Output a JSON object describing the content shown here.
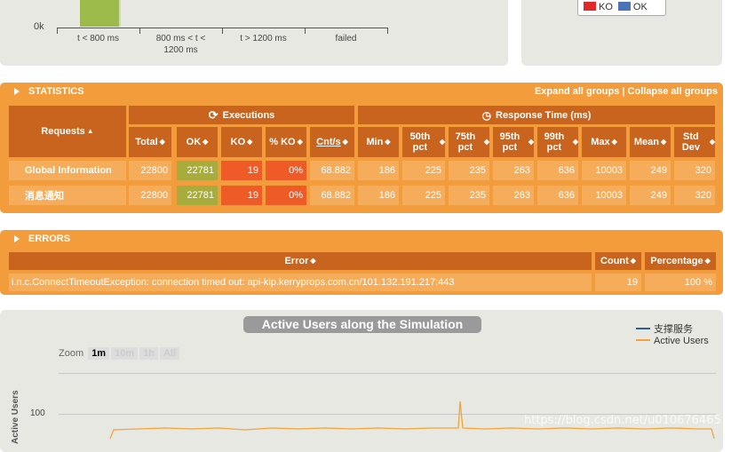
{
  "top_chart": {
    "y_tick": "0k",
    "x_labels": [
      "t < 800 ms",
      "800 ms < t <\n1200 ms",
      "t > 1200 ms",
      "failed"
    ],
    "legend": [
      {
        "label": "KO",
        "color": "#e02a2a"
      },
      {
        "label": "OK",
        "color": "#4a74b4"
      }
    ]
  },
  "statistics": {
    "title": "STATISTICS",
    "expand_link": "Expand all groups",
    "separator": "|",
    "collapse_link": "Collapse all groups",
    "group_executions": "Executions",
    "group_response_time": "Response Time (ms)",
    "requests_header": "Requests",
    "columns": [
      "Total",
      "OK",
      "KO",
      "% KO",
      "Cnt/s",
      "Min",
      "50th pct",
      "75th pct",
      "95th pct",
      "99th pct",
      "Max",
      "Mean",
      "Std Dev"
    ],
    "rows": [
      {
        "name": "Global Information",
        "values": [
          "22800",
          "22781",
          "19",
          "0%",
          "68.882",
          "186",
          "225",
          "235",
          "263",
          "636",
          "10003",
          "249",
          "320"
        ]
      },
      {
        "name": "消息通知",
        "values": [
          "22800",
          "22781",
          "19",
          "0%",
          "68.882",
          "186",
          "225",
          "235",
          "263",
          "636",
          "10003",
          "249",
          "320"
        ]
      }
    ]
  },
  "errors": {
    "title": "ERRORS",
    "headers": [
      "Error",
      "Count",
      "Percentage"
    ],
    "rows": [
      {
        "error": "i.n.c.ConnectTimeoutException: connection timed out: api-kip.kerryprops.com.cn/101.132.191.217:443",
        "count": "19",
        "percentage": "100 %"
      }
    ]
  },
  "active_users": {
    "title": "Active Users along the Simulation",
    "zoom_label": "Zoom",
    "zoom_options": [
      "1m",
      "10m",
      "1h",
      "All"
    ],
    "zoom_selected": "1m",
    "y_axis_label": "Active Users",
    "y_tick": "100",
    "legend": [
      {
        "label": "支撑服务",
        "color": "#2f5d9a"
      },
      {
        "label": "Active Users",
        "color": "#f3a33a"
      }
    ],
    "watermark": "https://blog.csdn.net/u010676465"
  },
  "colors": {
    "accent_orange": "#f39c3c",
    "header_dark": "#c9641e",
    "ok_green": "#a8ac3c",
    "ko_red": "#ee5b26"
  }
}
